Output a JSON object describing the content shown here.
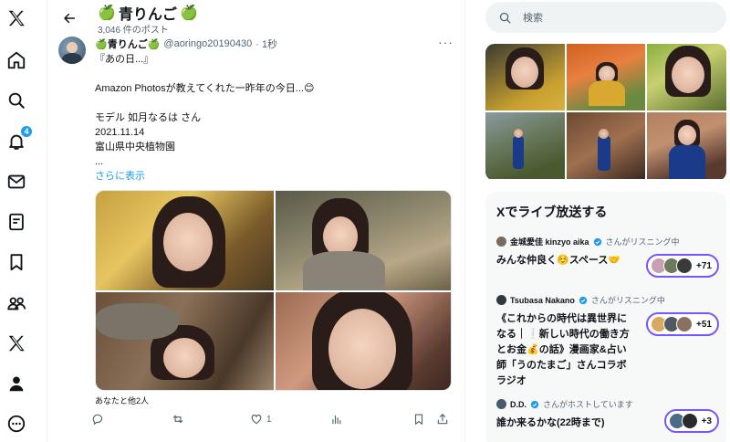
{
  "nav": {
    "notifications_badge": "4"
  },
  "header": {
    "back_label": "←",
    "title_name": "青りんご",
    "post_count": "3,046 件のポスト"
  },
  "tweet": {
    "display_name": "青りんご",
    "handle": "@aoringo20190430",
    "time": "· 1秒",
    "more": "···",
    "lines": [
      "『あの日...』",
      "",
      "Amazon Photosが教えてくれた一昨年の今日...😊",
      "",
      "モデル 如月なるは さん",
      "2021.11.14",
      "富山県中央植物園",
      "..."
    ],
    "show_more": "さらに表示",
    "liked_by": "あなたと他2人",
    "likes": "1"
  },
  "right": {
    "search_placeholder": "検索",
    "spaces": {
      "title": "Xでライブ放送する",
      "items": [
        {
          "host": "金城愛佳 kinzyo aika",
          "status": "さんがリスニング中",
          "title": "みんな仲良く☺️スペース🤝",
          "count": "+71"
        },
        {
          "host": "Tsubasa Nakano",
          "status": "さんがリスニング中",
          "title": "《これからの時代は異世界になる｜❕新しい時代の働き方とお金💰の話》漫画家&占い師「うのたまご」さんコラボラジオ",
          "count": "+51"
        },
        {
          "host": "D.D.",
          "status": "さんがホストしています",
          "title": "誰か来るかな(22時まで)",
          "count": "+3"
        }
      ]
    }
  },
  "colors": {
    "accent": "#1d9bf0",
    "spaces_purple": "#7856ff",
    "text_secondary": "#536471"
  },
  "icons": [
    "x-logo-icon",
    "home-icon",
    "search-icon",
    "bell-icon",
    "mail-icon",
    "list-icon",
    "bookmark-icon",
    "communities-icon",
    "premium-x-icon",
    "profile-icon",
    "more-circle-icon",
    "back-arrow-icon",
    "reply-icon",
    "repost-icon",
    "heart-icon",
    "analytics-icon",
    "share-icon",
    "verified-icon"
  ]
}
